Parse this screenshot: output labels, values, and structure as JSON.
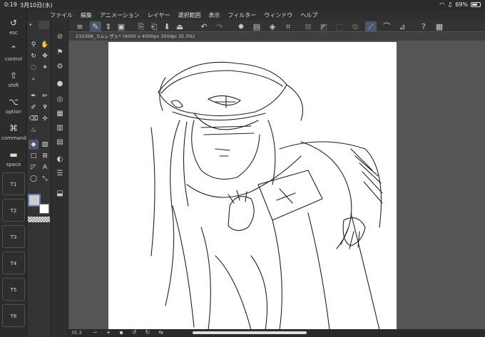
{
  "status": {
    "time": "0:19",
    "date": "3月10日(水)",
    "battery": "69%",
    "battery_level": 0.69
  },
  "menu": {
    "items": [
      "ファイル",
      "編集",
      "アニメーション",
      "レイヤー",
      "選択範囲",
      "表示",
      "フィルター",
      "ウィンドウ",
      "ヘルプ"
    ]
  },
  "modifiers": {
    "esc": "esc",
    "control": "control",
    "shift": "shift",
    "option": "option",
    "command": "command",
    "space": "space"
  },
  "tool_buttons": [
    "T1",
    "T2",
    "T3",
    "T4",
    "T5",
    "T6"
  ],
  "document": {
    "tab_title": "210308_ラムレザル* (4000 x 4000px 350dpi 35.3%)"
  },
  "bottom": {
    "zoom": "35.3"
  },
  "tools": {
    "text_tool": "A"
  },
  "colors": {
    "accent": "#4b5770",
    "main_color": "#cccccc",
    "sub_color": "#ffffff"
  }
}
